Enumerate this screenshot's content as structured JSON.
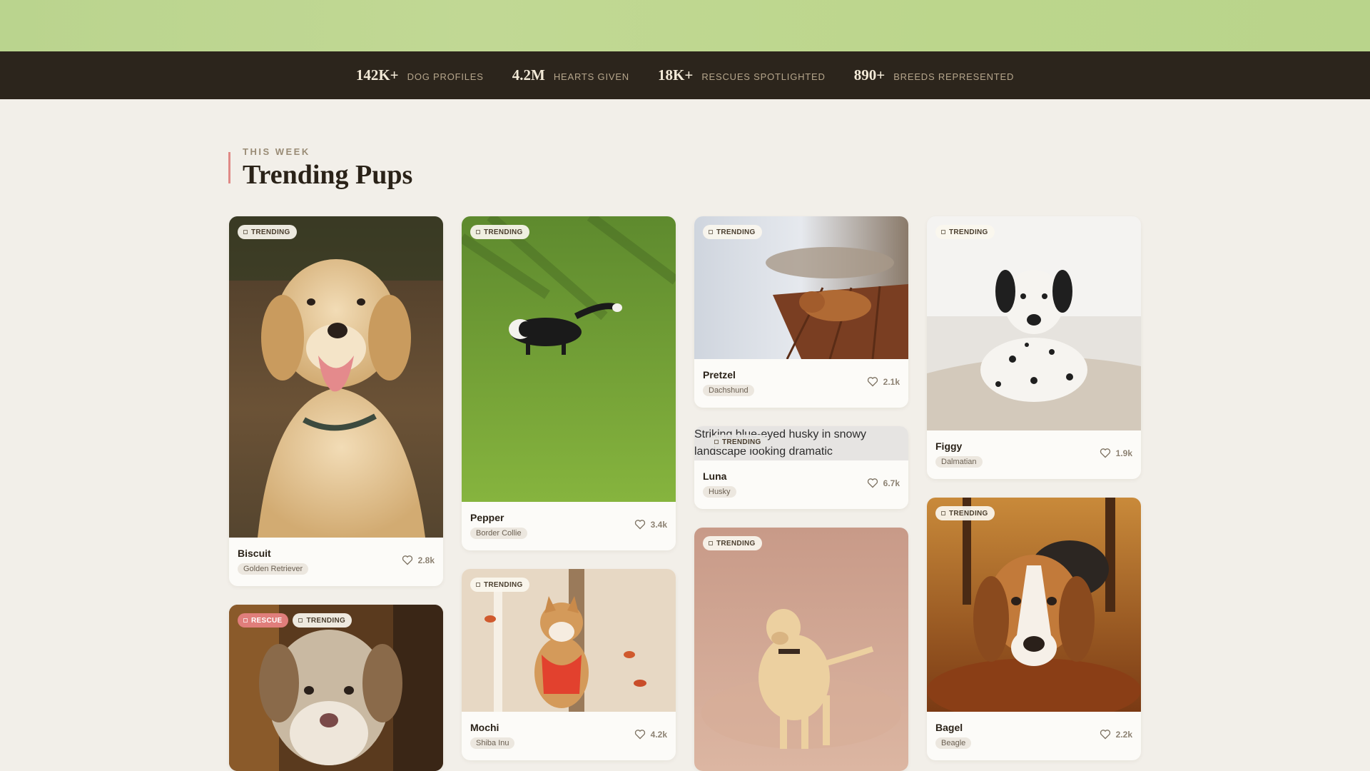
{
  "stats": [
    {
      "value": "142K+",
      "label": "DOG PROFILES"
    },
    {
      "value": "4.2M",
      "label": "HEARTS GIVEN"
    },
    {
      "value": "18K+",
      "label": "RESCUES SPOTLIGHTED"
    },
    {
      "value": "890+",
      "label": "BREEDS REPRESENTED"
    }
  ],
  "section": {
    "eyebrow": "THIS WEEK",
    "title": "Trending Pups"
  },
  "badges": {
    "trending": "TRENDING",
    "rescue": "RESCUE"
  },
  "cards": [
    {
      "name": "Biscuit",
      "breed": "Golden Retriever",
      "likes": "2.8k"
    },
    {
      "name": "Pepper",
      "breed": "Border Collie",
      "likes": "3.4k"
    },
    {
      "name": "Pretzel",
      "breed": "Dachshund",
      "likes": "2.1k"
    },
    {
      "name": "Luna",
      "breed": "Husky",
      "likes": "6.7k",
      "image_alt": "Striking blue-eyed husky in snowy landscape looking dramatic"
    },
    {
      "name": "Figgy",
      "breed": "Dalmatian",
      "likes": "1.9k"
    },
    {
      "name": "Mochi",
      "breed": "Shiba Inu",
      "likes": "4.2k"
    },
    {
      "name": "Bagel",
      "breed": "Beagle",
      "likes": "2.2k"
    },
    {
      "name": "",
      "breed": "",
      "likes": ""
    },
    {
      "name": "",
      "breed": "",
      "likes": ""
    }
  ],
  "colors": {
    "accent": "#e08a86",
    "stats_bg": "#2c251c",
    "hero": "#bcd68c",
    "page_bg": "#f2efe9"
  }
}
